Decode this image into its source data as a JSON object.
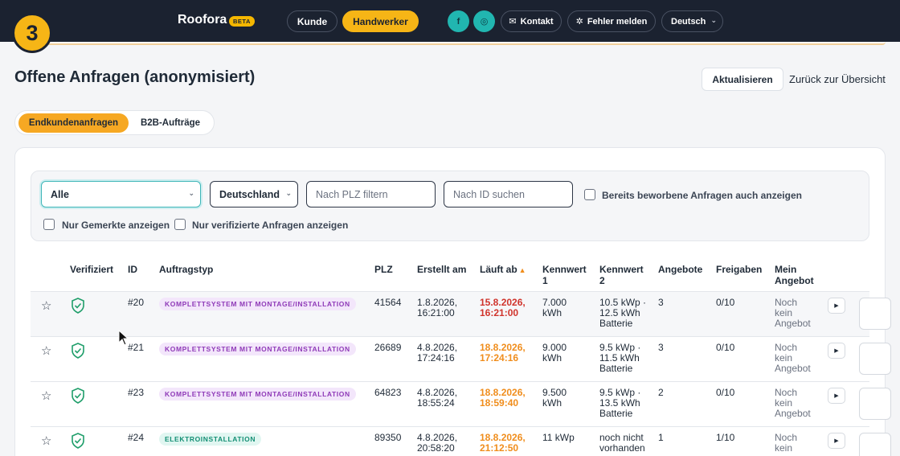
{
  "step_badge": "3",
  "header": {
    "brand": "Roofora",
    "beta": "BETA",
    "nav": {
      "kunde": "Kunde",
      "handwerker": "Handwerker"
    },
    "social": {
      "facebook": "f",
      "instagram": "◎"
    },
    "kontakt": "Kontakt",
    "fehler": "Fehler melden",
    "language": "Deutsch"
  },
  "page": {
    "title": "Offene Anfragen (anonymisiert)",
    "refresh": "Aktualisieren",
    "back": "Zurück zur Übersicht"
  },
  "tabs": [
    "Endkundenanfragen",
    "B2B-Aufträge"
  ],
  "filters": {
    "type_select": "Alle",
    "country_select": "Deutschland",
    "plz_placeholder": "Nach PLZ filtern",
    "id_placeholder": "Nach ID suchen",
    "already_applied": "Bereits beworbene Anfragen auch anzeigen",
    "only_saved": "Nur Gemerkte anzeigen",
    "only_verified": "Nur verifizierte Anfragen anzeigen"
  },
  "table": {
    "headers": {
      "verified": "Verifiziert",
      "id": "ID",
      "type": "Auftragstyp",
      "plz": "PLZ",
      "created": "Erstellt am",
      "expires": "Läuft ab",
      "k1a": "Kennwert",
      "k1b": "1",
      "k2a": "Kennwert",
      "k2b": "2",
      "offers": "Angebote",
      "releases": "Freigaben",
      "mine_a": "Mein",
      "mine_b": "Angebot"
    },
    "rows": [
      {
        "id": "#20",
        "type": "KOMPLETTSYSTEM MIT MONTAGE/INSTALLATION",
        "plz": "41564",
        "created_d": "1.8.2026,",
        "created_t": "16:21:00",
        "exp_d": "15.8.2026,",
        "exp_t": "16:21:00",
        "k1a": "7.000",
        "k1b": "kWh",
        "k2a": "10.5 kWp ·",
        "k2b": "12.5 kWh",
        "k2c": "Batterie",
        "offers": "3",
        "releases": "0/10",
        "mine_a": "Noch",
        "mine_b": "kein",
        "mine_c": "Angebot"
      },
      {
        "id": "#21",
        "type": "KOMPLETTSYSTEM MIT MONTAGE/INSTALLATION",
        "plz": "26689",
        "created_d": "4.8.2026,",
        "created_t": "17:24:16",
        "exp_d": "18.8.2026,",
        "exp_t": "17:24:16",
        "k1a": "9.000",
        "k1b": "kWh",
        "k2a": "9.5 kWp ·",
        "k2b": "11.5 kWh",
        "k2c": "Batterie",
        "offers": "3",
        "releases": "0/10",
        "mine_a": "Noch",
        "mine_b": "kein",
        "mine_c": "Angebot"
      },
      {
        "id": "#23",
        "type": "KOMPLETTSYSTEM MIT MONTAGE/INSTALLATION",
        "plz": "64823",
        "created_d": "4.8.2026,",
        "created_t": "18:55:24",
        "exp_d": "18.8.2026,",
        "exp_t": "18:59:40",
        "k1a": "9.500",
        "k1b": "kWh",
        "k2a": "9.5 kWp ·",
        "k2b": "13.5 kWh",
        "k2c": "Batterie",
        "offers": "2",
        "releases": "0/10",
        "mine_a": "Noch",
        "mine_b": "kein",
        "mine_c": "Angebot"
      },
      {
        "id": "#24",
        "type": "ELEKTROINSTALLATION",
        "plz": "89350",
        "created_d": "4.8.2026,",
        "created_t": "20:58:20",
        "exp_d": "18.8.2026,",
        "exp_t": "21:12:50",
        "k1a": "11 kWp",
        "k1b": "",
        "k2a": "noch nicht",
        "k2b": "vorhanden",
        "k2c": "",
        "offers": "1",
        "releases": "1/10",
        "mine_a": "Noch",
        "mine_b": "kein",
        "mine_c": ""
      }
    ]
  },
  "colors": {
    "accent": "#f6b516",
    "topbar": "#1b2230",
    "urgent": "#d0342c",
    "soon": "#f08d1c",
    "teal": "#21b6b0"
  }
}
